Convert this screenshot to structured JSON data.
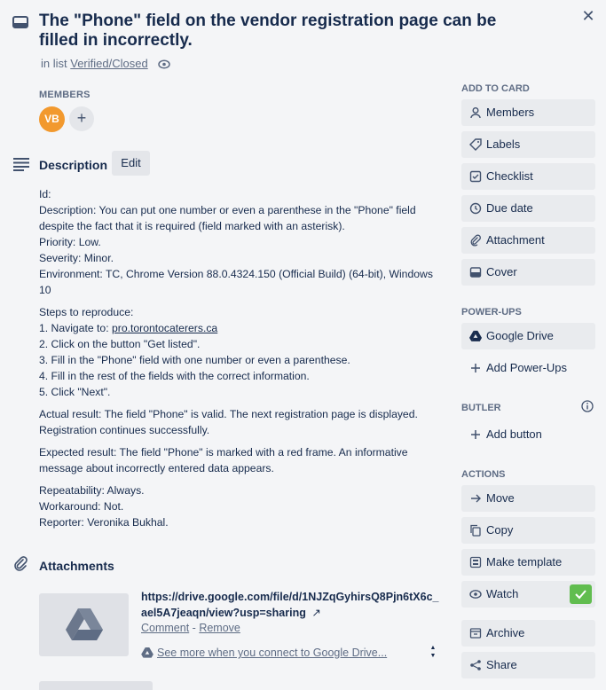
{
  "card": {
    "title": "The \"Phone\" field on the vendor registration page can be filled in incorrectly.",
    "in_list_prefix": "in list",
    "list_name": "Verified/Closed"
  },
  "members": {
    "label": "MEMBERS",
    "avatar_initials": "VB",
    "add_symbol": "+"
  },
  "description": {
    "title": "Description",
    "edit_label": "Edit",
    "lines": {
      "l1": "Id:",
      "l2": "Description: You can put one number or even a parenthese in the \"Phone\" field despite the fact that it is required (field marked with an asterisk).",
      "l3": "Priority: Low.",
      "l4": "Severity: Minor.",
      "l5": "Environment: TC, Chrome Version 88.0.4324.150 (Official Build) (64-bit), Windows 10",
      "s0": "Steps to reproduce:",
      "s1_prefix": "1. Navigate to: ",
      "s1_link": "pro.torontocaterers.ca",
      "s2": "2. Click on the button \"Get listed\".",
      "s3": "3. Fill in the \"Phone\" field with one number or even a parenthese.",
      "s4": "4. Fill in the rest of the fields with the correct information.",
      "s5": "5. Click \"Next\".",
      "actual": "Actual result: The field \"Phone\" is valid. The next registration page is displayed. Registration continues successfully.",
      "expected": "Expected result: The field \"Phone\" is marked with a red frame. An informative message about incorrectly entered data appears.",
      "rep": "Repeatability: Always.",
      "work": "Workaround: Not.",
      "reporter": "Reporter: Veronika Bukhal."
    }
  },
  "attachments": {
    "title": "Attachments",
    "link": "https://drive.google.com/file/d/1NJZqGyhirsQ8Pjn6tX6c_ael5A7jeaqn/view?usp=sharing",
    "arrow": "↗",
    "comment_label": "Comment",
    "separator": "-",
    "remove_label": "Remove",
    "gdrive_text": "See more when you connect to Google Drive..."
  },
  "sidebar": {
    "add_to_card_label": "ADD TO CARD",
    "add_to_card": [
      "Members",
      "Labels",
      "Checklist",
      "Due date",
      "Attachment",
      "Cover"
    ],
    "powerups_label": "POWER-UPS",
    "google_drive": "Google Drive",
    "add_powerups": "Add Power-Ups",
    "butler_label": "BUTLER",
    "add_button": "Add button",
    "actions_label": "ACTIONS",
    "actions": [
      "Move",
      "Copy",
      "Make template",
      "Watch",
      "Archive",
      "Share"
    ]
  },
  "colors": {
    "avatar": "#f2992e",
    "watch_check": "#61bd4f",
    "button_bg": "#e9ebee"
  }
}
